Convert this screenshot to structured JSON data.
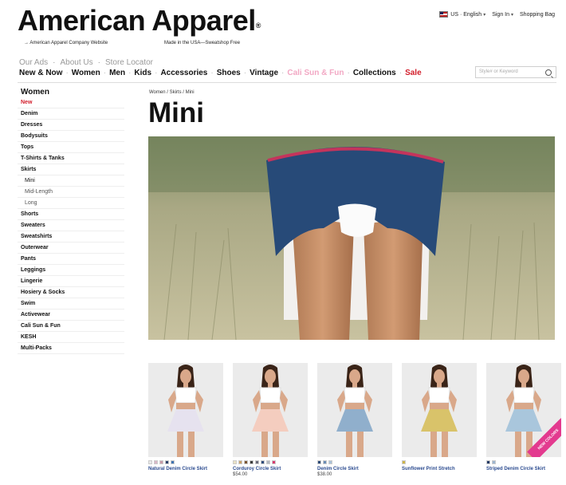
{
  "brand": {
    "name": "American Apparel",
    "reg": "®",
    "sub_left": "→ American Apparel Company Website",
    "sub_mid": "Made in the USA—Sweatshop Free"
  },
  "util": {
    "locale": "US · English",
    "signin": "Sign In",
    "bag": "Shopping Bag"
  },
  "tier1": [
    "Our Ads",
    "·",
    "About Us",
    "·",
    "Store Locator"
  ],
  "nav": [
    {
      "label": "New & Now",
      "style": ""
    },
    {
      "label": "Women",
      "style": ""
    },
    {
      "label": "Men",
      "style": ""
    },
    {
      "label": "Kids",
      "style": ""
    },
    {
      "label": "Accessories",
      "style": ""
    },
    {
      "label": "Shoes",
      "style": ""
    },
    {
      "label": "Vintage",
      "style": ""
    },
    {
      "label": "Cali Sun & Fun",
      "style": "pink"
    },
    {
      "label": "Collections",
      "style": ""
    },
    {
      "label": "Sale",
      "style": "red"
    }
  ],
  "search": {
    "placeholder": "Style# or Keyword"
  },
  "sidebar": {
    "title": "Women",
    "items": [
      {
        "label": "New",
        "cls": "red"
      },
      {
        "label": "Denim",
        "cls": ""
      },
      {
        "label": "Dresses",
        "cls": ""
      },
      {
        "label": "Bodysuits",
        "cls": ""
      },
      {
        "label": "Tops",
        "cls": ""
      },
      {
        "label": "T-Shirts & Tanks",
        "cls": ""
      },
      {
        "label": "Skirts",
        "cls": ""
      },
      {
        "label": "Mini",
        "cls": "sub active"
      },
      {
        "label": "Mid-Length",
        "cls": "sub"
      },
      {
        "label": "Long",
        "cls": "sub"
      },
      {
        "label": "Shorts",
        "cls": ""
      },
      {
        "label": "Sweaters",
        "cls": ""
      },
      {
        "label": "Sweatshirts",
        "cls": ""
      },
      {
        "label": "Outerwear",
        "cls": ""
      },
      {
        "label": "Pants",
        "cls": ""
      },
      {
        "label": "Leggings",
        "cls": ""
      },
      {
        "label": "Lingerie",
        "cls": ""
      },
      {
        "label": "Hosiery & Socks",
        "cls": ""
      },
      {
        "label": "Swim",
        "cls": ""
      },
      {
        "label": "Activewear",
        "cls": ""
      },
      {
        "label": "Cali Sun & Fun",
        "cls": ""
      },
      {
        "label": "KESH",
        "cls": ""
      },
      {
        "label": "Multi-Packs",
        "cls": ""
      }
    ]
  },
  "breadcrumb": "Women / Skirts / Mini",
  "page_title": "Mini",
  "products": [
    {
      "name": "Natural Denim Circle Skirt",
      "price": "",
      "skirt": "#e6e2ef",
      "top": "#ffffff",
      "swatches": [
        "#e8e8e8",
        "#d9b8c8",
        "#c89aa8",
        "#2a3f6a",
        "#3f73b0"
      ]
    },
    {
      "name": "Corduroy Circle Skirt",
      "price": "$54.00",
      "skirt": "#f4cdbf",
      "top": "#ffffff",
      "swatches": [
        "#e9e1c4",
        "#c8a26a",
        "#7a5432",
        "#3a3a3a",
        "#6a6a7a",
        "#2f4b7a",
        "#b3b8c0",
        "#d83a6e"
      ]
    },
    {
      "name": "Denim Circle Skirt",
      "price": "$38.00",
      "skirt": "#90afcc",
      "top": "#ffffff",
      "swatches": [
        "#2d4a77",
        "#6a8db6",
        "#a9c1d8"
      ]
    },
    {
      "name": "Sunflower Print Stretch",
      "price": "",
      "skirt": "#d9c36a",
      "top": "#ffffff",
      "swatches": [
        "#cdb54a"
      ]
    },
    {
      "name": "Striped Denim Circle Skirt",
      "price": "",
      "skirt": "#a9c6dc",
      "top": "#ffffff",
      "swatches": [
        "#253a66",
        "#9db6d0"
      ]
    }
  ],
  "new_badge": "NEW COLORS"
}
